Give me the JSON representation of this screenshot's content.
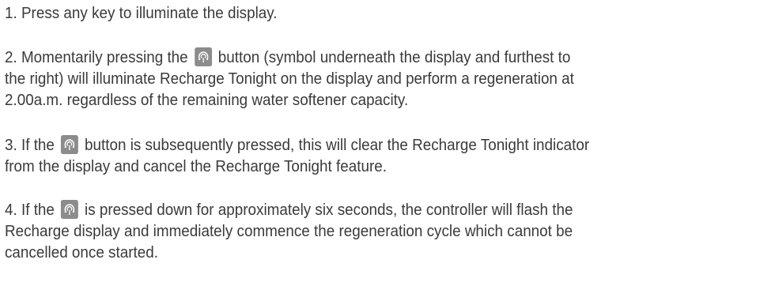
{
  "paragraphs": {
    "p1": {
      "line1": "1. Press any key to illuminate the display."
    },
    "p2": {
      "line1_before": "2. Momentarily pressing the",
      "line1_after": "button (symbol underneath the display and furthest to",
      "line2": "the right) will illuminate Recharge Tonight on the display and perform a regeneration at",
      "line3": "2.00a.m. regardless of the remaining water softener capacity."
    },
    "p3": {
      "line1_before": "3. If the",
      "line1_after": "button is subsequently pressed, this will clear the Recharge Tonight indicator",
      "line2": "from the display and cancel the Recharge Tonight feature."
    },
    "p4": {
      "line1_before": "4. If the",
      "line1_after": "is pressed down for approximately six seconds, the controller will flash the",
      "line2": "Recharge display and immediately commence the regeneration cycle which cannot be",
      "line3": "cancelled once started."
    }
  },
  "icon": {
    "name": "regeneration-button-icon",
    "bg_color": "#8c8c8c",
    "fg_color": "#ffffff"
  },
  "colors": {
    "text": "#3a3a3a",
    "background": "#ffffff"
  }
}
